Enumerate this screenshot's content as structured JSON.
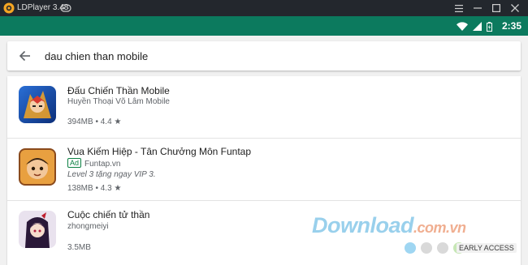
{
  "window": {
    "title": "LDPlayer 3.48",
    "logo_icon": "ldplayer-logo-icon",
    "gamepad_icon": "gamepad-icon",
    "controls": [
      "menu-icon",
      "minimize-icon",
      "restore-icon",
      "close-icon"
    ]
  },
  "statusbar": {
    "time": "2:35",
    "icons": [
      "wifi-icon",
      "signal-icon",
      "battery-icon"
    ],
    "color": "#0c7a5e"
  },
  "search": {
    "query": "dau chien than mobile",
    "back_icon": "back-arrow-icon"
  },
  "results": [
    {
      "title": "Đấu Chiến Thần Mobile",
      "developer": "Huyền Thoại Võ Lâm Mobile",
      "size": "394MB",
      "rating": "4.4",
      "star": "★",
      "icon": "app-icon-dau-chien-than"
    },
    {
      "title": "Vua Kiếm Hiệp - Tân Chưởng Môn Funtap",
      "ad_label": "Ad",
      "developer": "Funtap.vn",
      "promo": "Level 3 tặng ngay VIP 3.",
      "size": "138MB",
      "rating": "4.3",
      "star": "★",
      "icon": "app-icon-vua-kiem-hiep"
    },
    {
      "title": "Cuộc chiến tử thần",
      "developer": "zhongmeiyi",
      "size": "3.5MB",
      "icon": "app-icon-cuoc-chien-tu-than"
    }
  ],
  "watermark": {
    "main": "Download",
    "suffix": ".com.vn",
    "badge": "EARLY ACCESS",
    "dot_colors": [
      "#9fd6f2",
      "#d9d9d9",
      "#d9d9d9",
      "#c7e7b6"
    ]
  }
}
